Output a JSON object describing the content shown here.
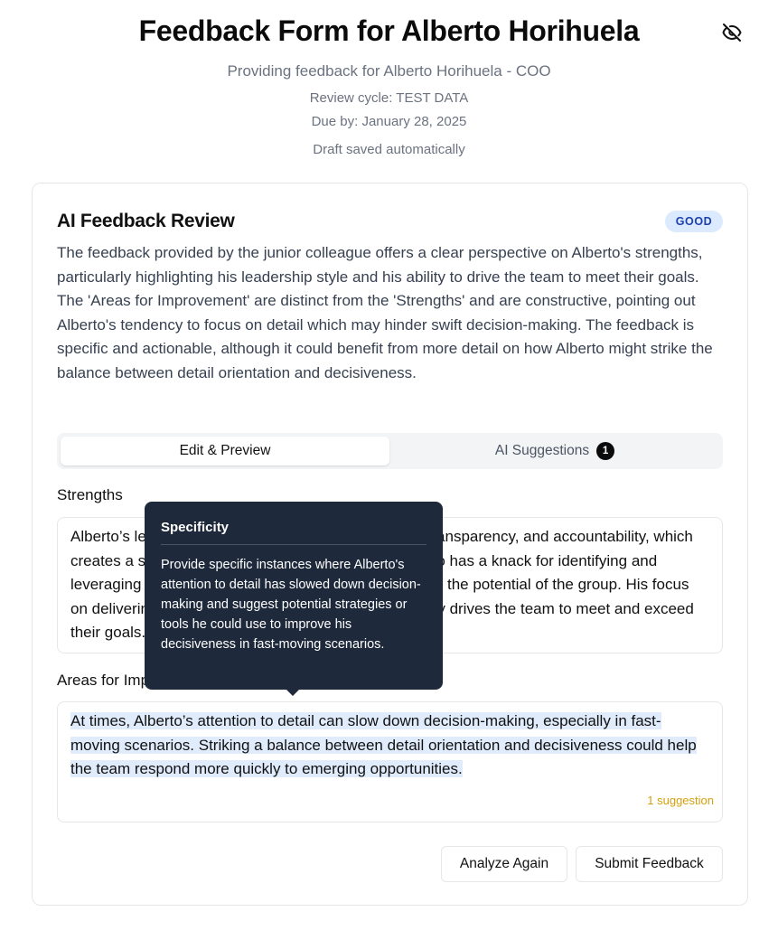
{
  "header": {
    "title": "Feedback Form for Alberto Horihuela",
    "subtitle": "Providing feedback for Alberto Horihuela - COO",
    "review_cycle": "Review cycle: TEST DATA",
    "due_by": "Due by: January 28, 2025",
    "draft_status": "Draft saved automatically",
    "visibility_icon": "eye-off-icon"
  },
  "review": {
    "title": "AI Feedback Review",
    "badge": "GOOD",
    "badge_color": "#dbeafe",
    "text": "The feedback provided by the junior colleague offers a clear perspective on Alberto's strengths, particularly highlighting his leadership style and his ability to drive the team to meet their goals. The 'Areas for Improvement' are distinct from the 'Strengths' and are constructive, pointing out Alberto's tendency to focus on detail which may hinder swift decision-making. The feedback is specific and actionable, although it could benefit from more detail on how Alberto might strike the balance between detail orientation and decisiveness."
  },
  "tabs": {
    "edit": "Edit & Preview",
    "ai": "AI Suggestions",
    "ai_count": "1"
  },
  "strengths": {
    "label": "Strengths",
    "value": "Alberto’s leadership style emphasizes collaboration, transparency, and accountability, which creates a strong sense of trust within the team. He also has a knack for identifying and leveraging each team member’s strengths to maximize the potential of the group. His focus on delivering results is unwavering, and he consistently drives the team to meet and exceed their goals."
  },
  "areas": {
    "label": "Areas for Improvement",
    "value": "At times, Alberto’s attention to detail can slow down decision-making, especially in fast-moving scenarios. Striking a balance between detail orientation and decisiveness could help the team respond more quickly to emerging opportunities.",
    "suggestion_count": "1 suggestion",
    "highlight_color": "#e0ecfb"
  },
  "tooltip": {
    "title": "Specificity",
    "body": "Provide specific instances where Alberto's attention to detail has slowed down decision-making and suggest potential strategies or tools he could use to improve his decisiveness in fast-moving scenarios."
  },
  "actions": {
    "analyze": "Analyze Again",
    "submit": "Submit Feedback"
  }
}
